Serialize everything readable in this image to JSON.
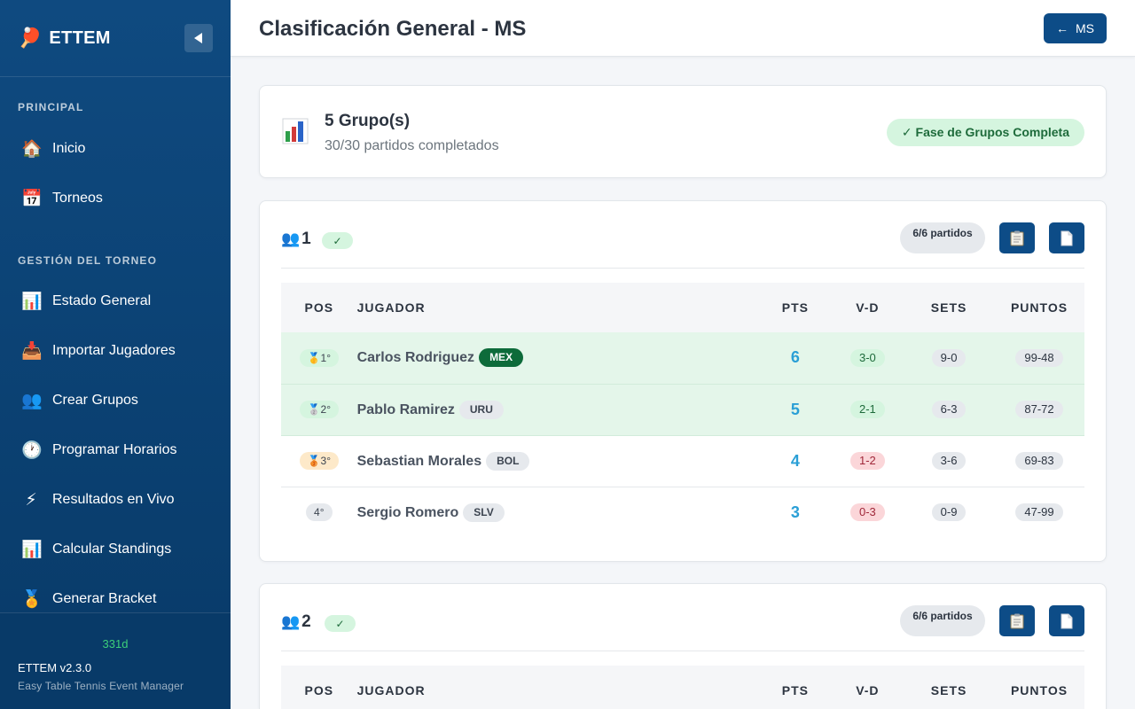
{
  "sidebar": {
    "brand": "ETTEM",
    "sections": [
      {
        "label": "PRINCIPAL"
      },
      {
        "label": "GESTIÓN DEL TORNEO"
      }
    ],
    "items": [
      {
        "icon": "home-icon",
        "label": "Inicio"
      },
      {
        "icon": "calendar-icon",
        "label": "Torneos"
      },
      {
        "icon": "bar-chart-icon",
        "label": "Estado General"
      },
      {
        "icon": "inbox-tray-icon",
        "label": "Importar Jugadores"
      },
      {
        "icon": "people-icon",
        "label": "Crear Grupos"
      },
      {
        "icon": "clock-icon",
        "label": "Programar Horarios"
      },
      {
        "icon": "lightning-icon",
        "label": "Resultados en Vivo"
      },
      {
        "icon": "bar-chart-icon",
        "label": "Calcular Standings"
      },
      {
        "icon": "medal-icon",
        "label": "Generar Bracket"
      }
    ],
    "footer": {
      "days": "331d",
      "version": "ETTEM v2.3.0",
      "subtitle": "Easy Table Tennis Event Manager"
    }
  },
  "header": {
    "title": "Clasificación General - MS",
    "back_label": "MS",
    "back_arrow": "←"
  },
  "summary": {
    "title": "5 Grupo(s)",
    "subtitle": "30/30 partidos completados",
    "status": "✓ Fase de Grupos Completa"
  },
  "columns": {
    "pos": "POS",
    "player": "JUGADOR",
    "pts": "PTS",
    "vd": "V-D",
    "sets": "SETS",
    "points": "PUNTOS"
  },
  "groups": [
    {
      "number": "1",
      "check": "✓",
      "matches": "6/6 partidos",
      "rows": [
        {
          "pos": "🥇1°",
          "name": "Carlos Rodriguez",
          "country": "MEX",
          "pts": "6",
          "vd": "3-0",
          "sets": "9-0",
          "points": "99-48"
        },
        {
          "pos": "🥈2°",
          "name": "Pablo Ramirez",
          "country": "URU",
          "pts": "5",
          "vd": "2-1",
          "sets": "6-3",
          "points": "87-72"
        },
        {
          "pos": "🥉3°",
          "name": "Sebastian Morales",
          "country": "BOL",
          "pts": "4",
          "vd": "1-2",
          "sets": "3-6",
          "points": "69-83"
        },
        {
          "pos": "4°",
          "name": "Sergio Romero",
          "country": "SLV",
          "pts": "3",
          "vd": "0-3",
          "sets": "0-9",
          "points": "47-99"
        }
      ]
    },
    {
      "number": "2",
      "check": "✓",
      "matches": "6/6 partidos"
    }
  ],
  "colors": {
    "sidebar": "#0f4a80",
    "primary": "#0d4c87",
    "points": "#2a9fd6",
    "qualified_row": "#e4f6ea"
  }
}
